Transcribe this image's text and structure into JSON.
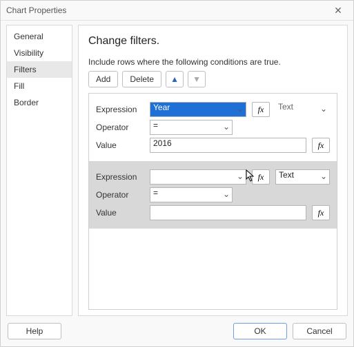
{
  "window": {
    "title": "Chart Properties"
  },
  "sidebar": {
    "items": [
      {
        "label": "General"
      },
      {
        "label": "Visibility"
      },
      {
        "label": "Filters"
      },
      {
        "label": "Fill"
      },
      {
        "label": "Border"
      }
    ],
    "activeIndex": 2
  },
  "main": {
    "heading": "Change filters.",
    "description": "Include rows where the following conditions are true.",
    "toolbar": {
      "add_label": "Add",
      "delete_label": "Delete"
    }
  },
  "type_options": [
    "Text"
  ],
  "filters": [
    {
      "expression_label": "Expression",
      "expression_value": "Year",
      "type_label": "Text",
      "operator_label": "Operator",
      "operator_value": "=",
      "value_label": "Value",
      "value_value": "2016"
    },
    {
      "expression_label": "Expression",
      "expression_value": "",
      "type_label": "Text",
      "operator_label": "Operator",
      "operator_value": "=",
      "value_label": "Value",
      "value_value": ""
    }
  ],
  "footer": {
    "help_label": "Help",
    "ok_label": "OK",
    "cancel_label": "Cancel"
  },
  "icons": {
    "fx": "fx",
    "up": "▲",
    "down": "▼",
    "chev": "⌄",
    "close": "✕"
  }
}
